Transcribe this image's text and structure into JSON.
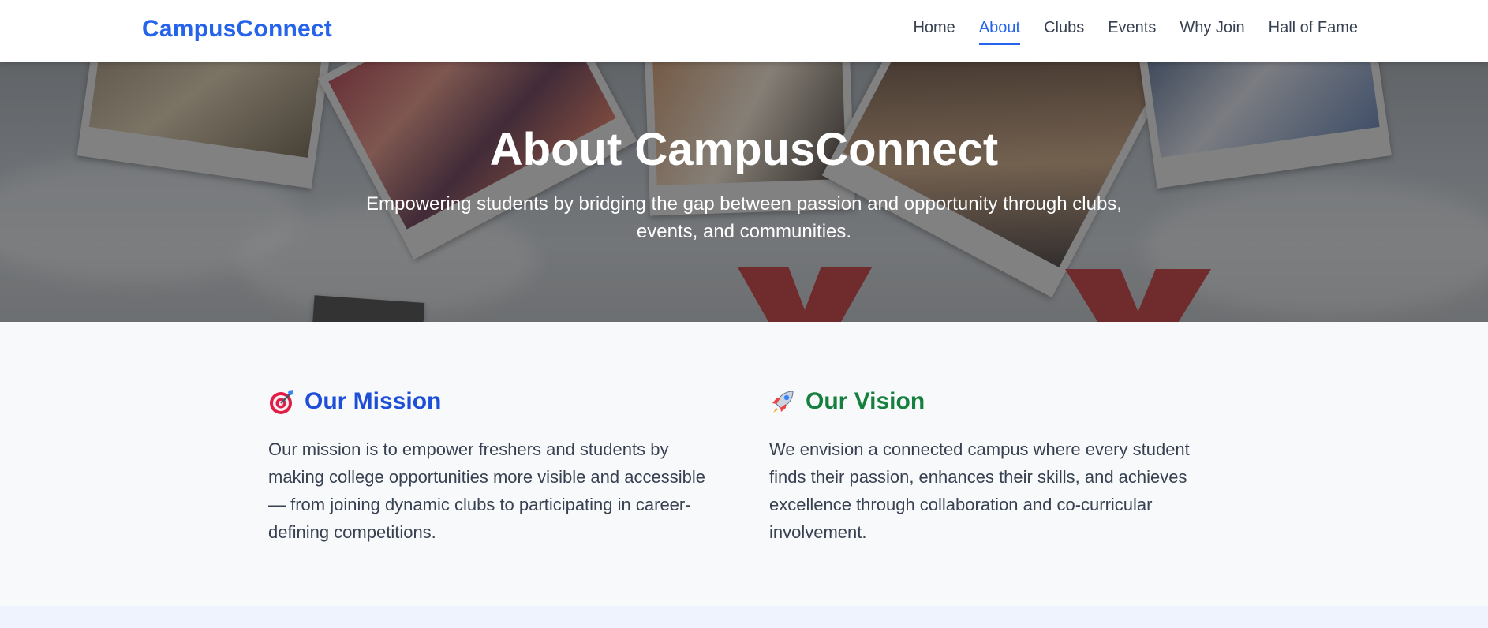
{
  "nav": {
    "brand": "CampusConnect",
    "links": [
      {
        "label": "Home",
        "active": false
      },
      {
        "label": "About",
        "active": true
      },
      {
        "label": "Clubs",
        "active": false
      },
      {
        "label": "Events",
        "active": false
      },
      {
        "label": "Why Join",
        "active": false
      },
      {
        "label": "Hall of Fame",
        "active": false
      }
    ]
  },
  "hero": {
    "title": "About CampusConnect",
    "subtitle": "Empowering students by bridging the gap between passion and opportunity through clubs, events, and communities."
  },
  "mission": {
    "icon": "target-icon",
    "title": "Our Mission",
    "text": "Our mission is to empower freshers and students by making college opportunities more visible and accessible — from joining dynamic clubs to participating in career-defining competitions."
  },
  "vision": {
    "icon": "rocket-icon",
    "title": "Our Vision",
    "text": "We envision a connected campus where every student finds their passion, enhances their skills, and achieves excellence through collaboration and co-curricular involvement."
  },
  "colors": {
    "brand": "#2563eb",
    "mission_title": "#1d4ed8",
    "vision_title": "#15803d",
    "section_bg": "#f8f9fb"
  }
}
